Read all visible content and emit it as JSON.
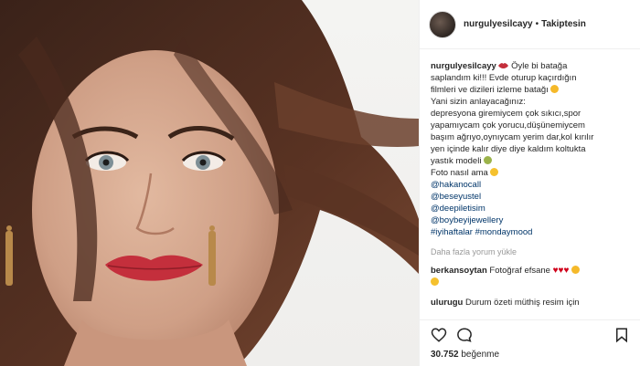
{
  "post": {
    "photo_icon": "portrait-photo"
  },
  "header": {
    "username": "nurgulyesilcayy",
    "separator": "•",
    "follow_status": "Takiptesin"
  },
  "caption": {
    "username": "nurgulyesilcayy",
    "lines": [
      "Öyle bi batağa",
      "saplandım ki!!! Evde oturup kaçırdığın",
      "filmleri ve dizileri izleme batağı",
      "Yani sizin anlayacağınız:",
      "depresyona giremiycem çok sıkıcı,spor",
      "yapamıycam çok yorucu,düşünemiycem",
      "başım ağrıyo,oynıycam yerim dar,kol kırılır",
      "yen içinde kalır diye diye kaldım koltukta",
      "yastık modeli",
      "Foto nasıl ama"
    ],
    "mentions": [
      "@hakanocall",
      "@beseyustel",
      "@deepiletisim",
      "@boybeyijewellery"
    ],
    "hashtags": "#iyihaftalar #mondaymood"
  },
  "load_more": "Daha fazla yorum yükle",
  "comments": [
    {
      "username": "berkansoytan",
      "text": "Fotoğraf efsane"
    },
    {
      "username": "ulurugu",
      "text": "Durum özeti müthiş resim için"
    }
  ],
  "actions": {
    "like_icon": "heart-icon",
    "comment_icon": "comment-icon",
    "save_icon": "bookmark-icon"
  },
  "likes": {
    "count": "30.752",
    "label": "beğenme"
  },
  "colors": {
    "link": "#003569",
    "text": "#262626",
    "muted": "#999999",
    "heart": "#d0021b"
  }
}
